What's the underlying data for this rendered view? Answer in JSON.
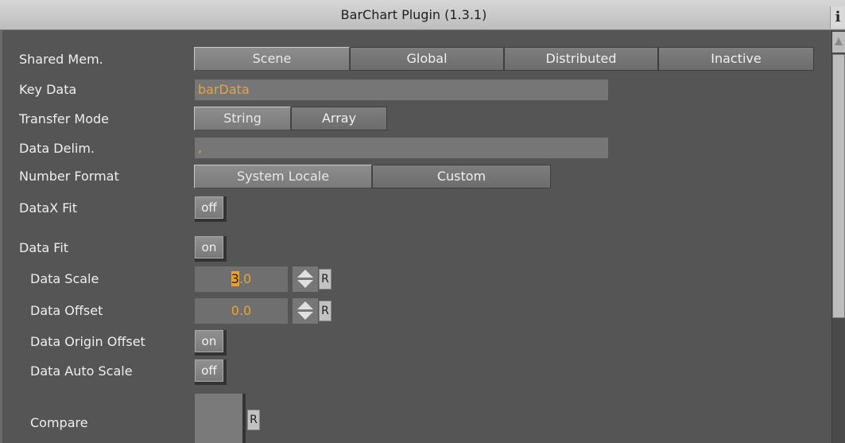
{
  "window": {
    "title": "BarChart Plugin (1.3.1)",
    "info_glyph": "i"
  },
  "shared_mem": {
    "label": "Shared Mem.",
    "options": [
      "Scene",
      "Global",
      "Distributed",
      "Inactive"
    ],
    "selected": "Scene"
  },
  "key_data": {
    "label": "Key Data",
    "value": "barData"
  },
  "transfer_mode": {
    "label": "Transfer Mode",
    "options": [
      "String",
      "Array"
    ],
    "selected": "String"
  },
  "data_delim": {
    "label": "Data Delim.",
    "value": ","
  },
  "number_format": {
    "label": "Number Format",
    "options": [
      "System Locale",
      "Custom"
    ],
    "selected": "System Locale"
  },
  "datax_fit": {
    "label": "DataX Fit",
    "value": "off"
  },
  "data_fit": {
    "label": "Data Fit",
    "value": "on"
  },
  "data_scale": {
    "label": "Data Scale",
    "value_selected": "3",
    "value_rest": ".0",
    "reset": "R"
  },
  "data_offset": {
    "label": "Data Offset",
    "value": "0.0",
    "reset": "R"
  },
  "data_origin_offset": {
    "label": "Data Origin Offset",
    "value": "on"
  },
  "data_auto_scale": {
    "label": "Data Auto Scale",
    "value": "off"
  },
  "compare": {
    "label": "Compare",
    "reset": "R"
  },
  "colors": {
    "background": "#555555",
    "value_text": "#e9a33a",
    "selection": "#f0a020",
    "titlebar": "#cccccc"
  }
}
